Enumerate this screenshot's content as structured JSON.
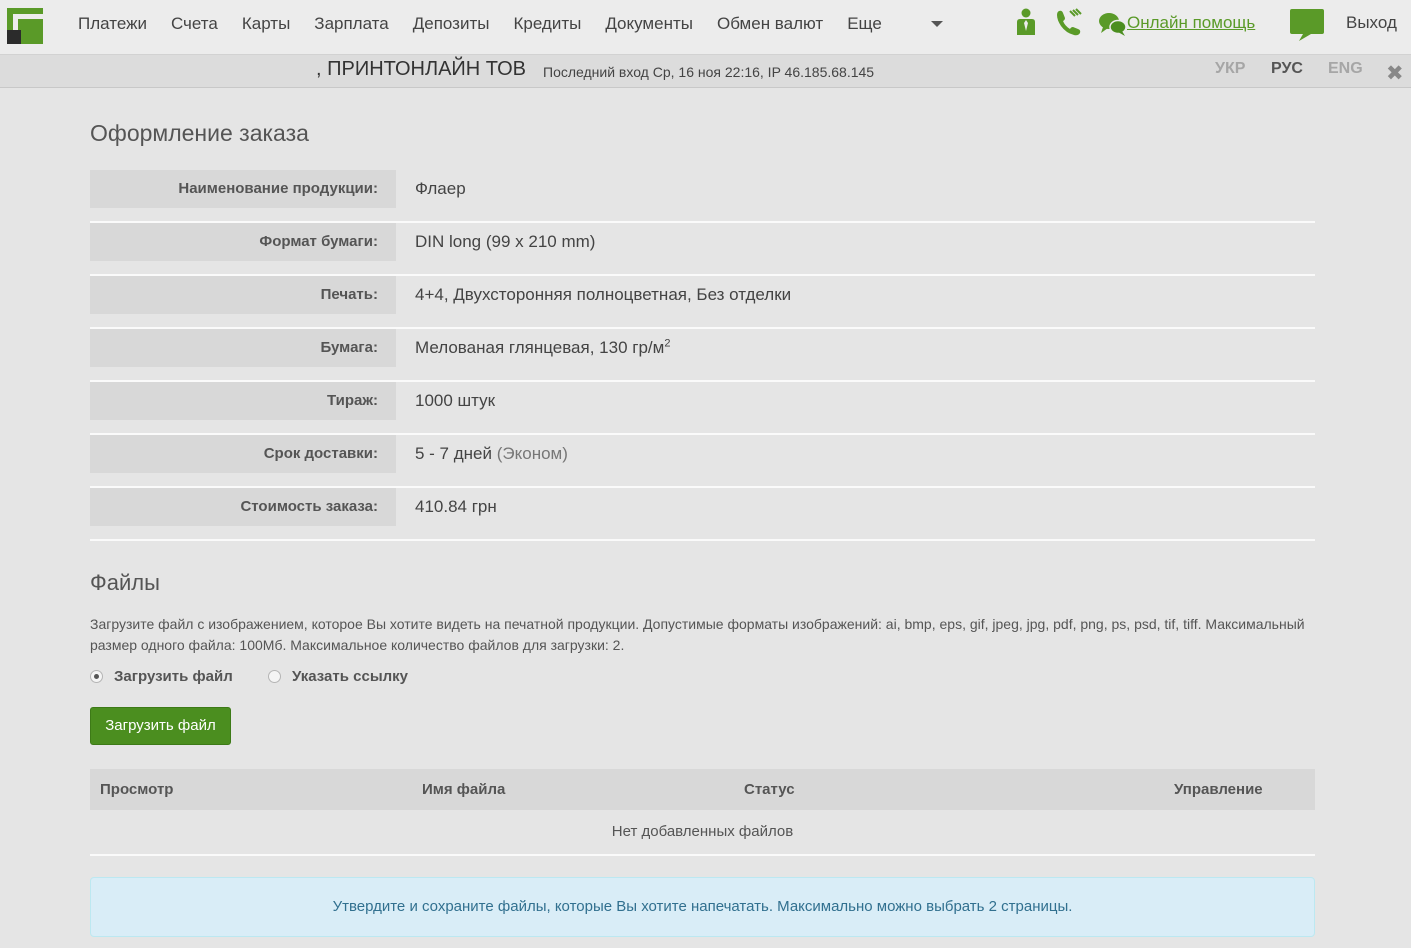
{
  "nav": {
    "items": [
      "Платежи",
      "Счета",
      "Карты",
      "Зарплата",
      "Депозиты",
      "Кредиты",
      "Документы",
      "Обмен валют",
      "Еще"
    ],
    "help_label": "Онлайн помощь",
    "logout_label": "Выход"
  },
  "subheader": {
    "company": ", ПРИНТОНЛАЙН ТОВ",
    "last_login": "Последний вход Ср, 16 ноя 22:16, IP 46.185.68.145",
    "languages": [
      "УКР",
      "РУС",
      "ENG"
    ],
    "active_language": "РУС"
  },
  "order": {
    "title": "Оформление заказа",
    "rows": [
      {
        "label": "Наименование продукции:",
        "value": "Флаер"
      },
      {
        "label": "Формат бумаги:",
        "value": "DIN long (99 x 210 mm)"
      },
      {
        "label": "Печать:",
        "value": "4+4, Двухсторонняя полноцветная, Без отделки"
      },
      {
        "label": "Бумага:",
        "value": "Мелованая глянцевая, 130 гр/м",
        "sup": "2"
      },
      {
        "label": "Тираж:",
        "value": "1000 штук"
      },
      {
        "label": "Срок доставки:",
        "value": "5 - 7 дней",
        "note": "(Эконом)"
      },
      {
        "label": "Стоимость заказа:",
        "value": "410.84 грн"
      }
    ]
  },
  "files": {
    "title": "Файлы",
    "description": "Загрузите файл с изображением, которое Вы хотите видеть на печатной продукции. Допустимые форматы изображений: ai, bmp, eps, gif, jpeg, jpg, pdf, png, ps, psd, tif, tiff. Максимальный размер одного файла: 100Мб. Максимальное количество файлов для загрузки: 2.",
    "radio_upload": "Загрузить файл",
    "radio_link": "Указать ссылку",
    "selected_option": "upload",
    "upload_button": "Загрузить файл",
    "table": {
      "columns": [
        "Просмотр",
        "Имя файла",
        "Статус",
        "Управление"
      ],
      "empty_text": "Нет добавленных файлов"
    },
    "info": "Утвердите и сохраните файлы, которые Вы хотите напечатать. Максимально можно выбрать 2 страницы."
  },
  "colors": {
    "brand_green": "#5a9a28",
    "button_green": "#4b8e1f",
    "info_bg": "#d9edf7",
    "info_text": "#31708f"
  },
  "icons": [
    "logo-icon",
    "person-icon",
    "phone-icon",
    "chat-icon",
    "message-icon",
    "close-icon",
    "dropdown-caret-icon"
  ]
}
